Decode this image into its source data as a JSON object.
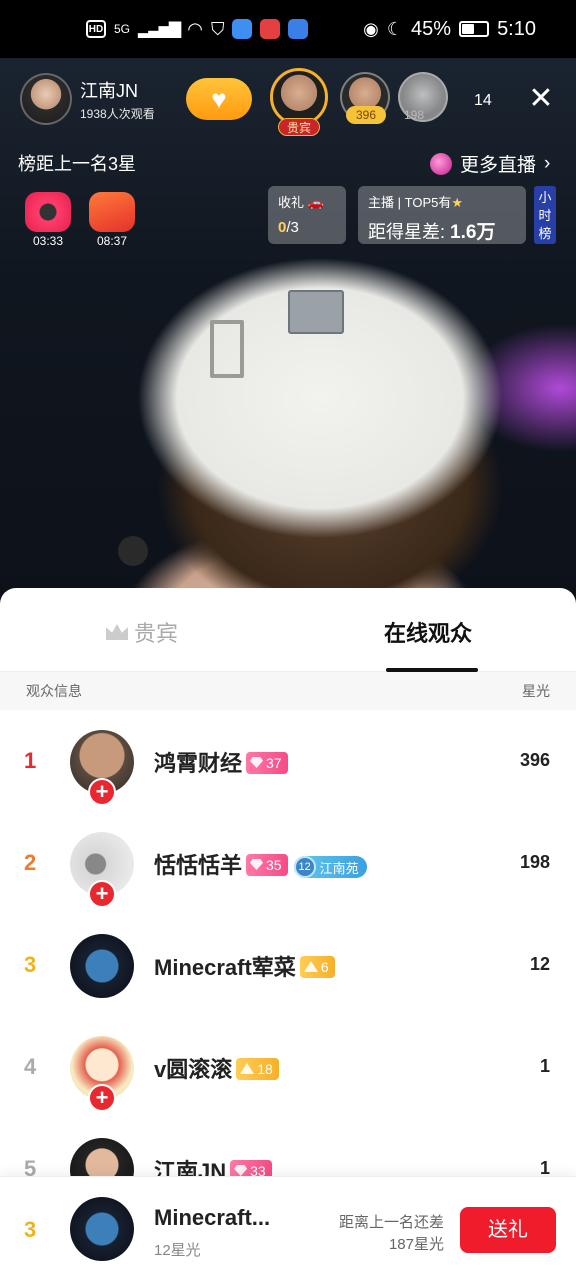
{
  "status_bar": {
    "hd": "HD",
    "signal": "5G",
    "battery": "45%",
    "battery_level": 0.45,
    "time": "5:10"
  },
  "live": {
    "host": {
      "name": "江南JN",
      "views": "1938人次观看"
    },
    "top_viewers": [
      {
        "tag": "贵宾"
      },
      {
        "badge": "396"
      },
      {
        "badge": "198"
      }
    ],
    "online_count": "14",
    "rank_tip": "榜距上一名3星",
    "more_live": "更多直播",
    "treasures": [
      {
        "time": "03:33"
      },
      {
        "time": "08:37"
      }
    ],
    "gift_task": {
      "label": "收礼",
      "progress": "0",
      "total": "/3"
    },
    "top5": {
      "label_host": "主播",
      "label_top5": "TOP5有",
      "gap_label": "距得星差:",
      "gap_value": "1.6万"
    },
    "hour_rank": [
      "小",
      "时",
      "榜"
    ]
  },
  "sheet": {
    "tabs": {
      "vip": "贵宾",
      "online": "在线观众"
    },
    "header": {
      "left": "观众信息",
      "right": "星光"
    },
    "rows": [
      {
        "rank": "1",
        "name": "鸿霄财经",
        "level": "37",
        "score": "396",
        "follow": "+"
      },
      {
        "rank": "2",
        "name": "恬恬恬羊",
        "level": "35",
        "club_level": "12",
        "club_name": "江南苑",
        "score": "198",
        "follow": "+"
      },
      {
        "rank": "3",
        "name": "Minecraft荤菜",
        "level": "6",
        "score": "12"
      },
      {
        "rank": "4",
        "name": "v圆滚滚",
        "level": "18",
        "score": "1",
        "follow": "+"
      },
      {
        "rank": "5",
        "name": "江南JN",
        "level": "33",
        "score": "1"
      }
    ]
  },
  "my_bar": {
    "rank": "3",
    "name": "Minecraft...",
    "sub": "12星光",
    "gap_line1": "距离上一名还差",
    "gap_line2": "187星光",
    "send_label": "送礼"
  }
}
